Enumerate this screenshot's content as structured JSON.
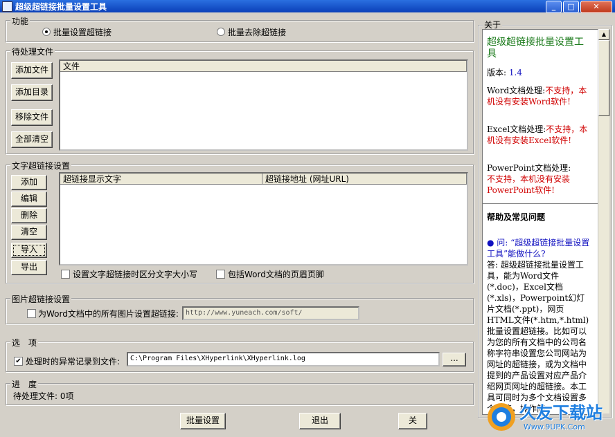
{
  "window": {
    "title": "超级超链接批量设置工具",
    "min": "_",
    "max": "□",
    "close": "✕"
  },
  "function_group": {
    "title": "功能",
    "opt_set": "批量设置超链接",
    "opt_remove": "批量去除超链接",
    "selected": "opt_set"
  },
  "files_group": {
    "title": "待处理文件",
    "add_file": "添加文件",
    "add_dir": "添加目录",
    "remove_file": "移除文件",
    "clear_all": "全部清空",
    "col_file": "文件"
  },
  "text_link_group": {
    "title": "文字超链接设置",
    "add": "添加",
    "edit": "编辑",
    "delete": "删除",
    "clear": "清空",
    "import": "导入",
    "export": "导出",
    "col_text": "超链接显示文字",
    "col_url": "超链接地址 (网址URL)",
    "chk_case": "设置文字超链接时区分文字大小写",
    "chk_header": "包括Word文档的页眉页脚",
    "chk_case_checked": false,
    "chk_header_checked": false
  },
  "image_link_group": {
    "title": "图片超链接设置",
    "chk_label": "为Word文档中的所有图片设置超链接:",
    "chk_checked": false,
    "url_value": "http://www.yuneach.com/soft/"
  },
  "options_group": {
    "title": "选　项",
    "chk_label": "处理时的异常记录到文件:",
    "chk_checked": true,
    "path_value": "C:\\Program Files\\XHyperlink\\XHyperlink.log",
    "browse": "..."
  },
  "progress_group": {
    "title": "进　度",
    "pending": "待处理文件: 0项"
  },
  "bottom": {
    "batch_set": "批量设置",
    "exit": "退出",
    "partial": "关"
  },
  "about": {
    "title": "关于",
    "app_name": "超级超链接批量设置工具",
    "version_label": "版本:",
    "version": "1.4",
    "word_label": "Word文档处理:",
    "word_status": "不支持，本机没有安装Word软件!",
    "excel_label": "Excel文档处理:",
    "excel_status": "不支持，本机没有安装Excel软件!",
    "ppt_label": "PowerPoint文档处理:",
    "ppt_status": "不支持，本机没有安装PowerPoint软件!",
    "help_title": "帮助及常见问题",
    "faq_q": "● 问: “超级超链接批量设置工具”能做什么?",
    "faq_a": "答: 超级超链接批量设置工具，能为Word文件(*.doc)，Excel文档(*.xls)，Powerpoint幻灯片文档(*.ppt)，网页HTML文件(*.htm,*.html)批量设置超链接。比如可以为您的所有文档中的公司名称字符串设置您公司网站为网址的超链接，或为文档中提到的产品设置对应产品介绍网页网址的超链接。本工具可同时为多个文档设置多个链接，操作简"
  },
  "watermark": {
    "brand": "久友下载站",
    "url": "Www.9UPK.Com"
  },
  "colors": {
    "link_green": "#1a7a1a",
    "link_blue": "#1010c0",
    "warn_red": "#d00000",
    "title_blue": "#0a3fb8"
  }
}
